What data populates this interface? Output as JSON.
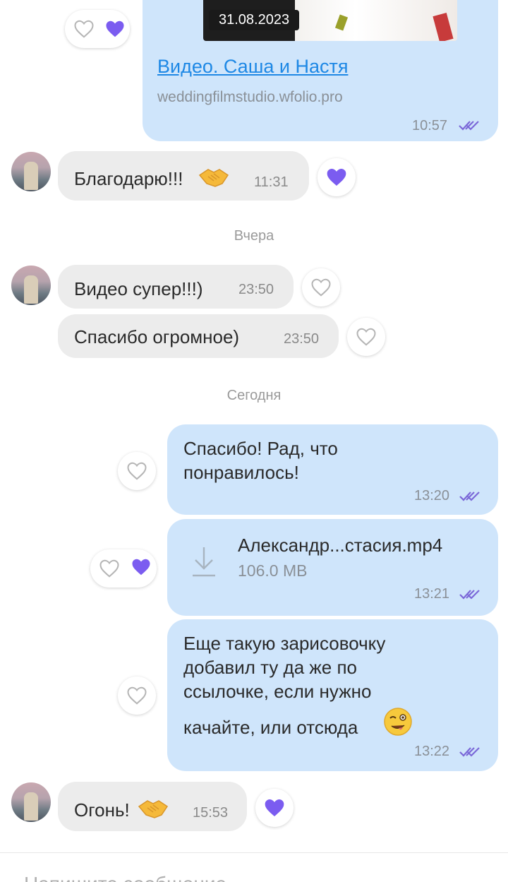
{
  "messages": {
    "video_card": {
      "thumb_date": "31.08.2023",
      "link_title": "Видео. Саша и Настя",
      "link_domain": "weddingfilmstudio.wfolio.pro",
      "time": "10:57"
    },
    "in_1": {
      "text": "Благодарю!!!",
      "emoji": "handshake-emoji",
      "time": "11:31"
    },
    "separator_yesterday": "Вчера",
    "in_2": {
      "text": "Видео супер!!!)",
      "time": "23:50"
    },
    "in_3": {
      "text": "Спасибо огромное)",
      "time": "23:50"
    },
    "separator_today": "Сегодня",
    "out_1": {
      "line1": "Спасибо! Рад, что",
      "line2": "понравилось!",
      "time": "13:20"
    },
    "out_file": {
      "file_name": "Александр...стасия.mp4",
      "file_size": "106.0 MB",
      "time": "13:21"
    },
    "out_2": {
      "line1": "Еще такую зарисовочку",
      "line2": "добавил ту да же по",
      "line3": "ссылочке, если нужно",
      "line4": "качайте, или отсюда",
      "emoji": "winking-face-emoji",
      "time": "13:22"
    },
    "in_4": {
      "text": "Огонь!",
      "emoji": "handshake-emoji",
      "time": "15:53"
    }
  },
  "composer": {
    "placeholder": "Напишите сообщение..."
  },
  "colors": {
    "incoming_bubble": "#ececec",
    "outgoing_bubble": "#cfe5fb",
    "reaction_purple": "#7b5cf0",
    "link_blue": "#1e88e5",
    "tick_purple": "#7b68d8"
  }
}
